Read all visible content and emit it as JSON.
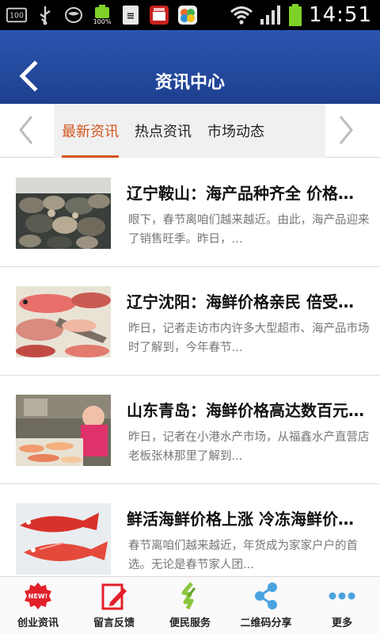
{
  "status_bar": {
    "time": "14:51",
    "battery_percent_label": "100%",
    "icons": [
      "storage-100-icon",
      "usb-icon",
      "mask-icon",
      "battery-100-icon",
      "ime-icon",
      "news-app-icon",
      "flower-app-icon",
      "wifi-icon",
      "signal-icon",
      "battery-icon"
    ]
  },
  "header": {
    "title": "资讯中心",
    "back_icon": "chevron-left-icon"
  },
  "tabs": {
    "items": [
      {
        "label": "最新资讯",
        "active": true
      },
      {
        "label": "热点资讯",
        "active": false
      },
      {
        "label": "市场动态",
        "active": false
      }
    ],
    "accent_color": "#d2541d"
  },
  "news": [
    {
      "title": "辽宁鞍山：海产品种齐全 价格平稳",
      "summary": "眼下，春节离咱们越来越近。由此，海产品迎来了销售旺季。昨日，..."
    },
    {
      "title": "辽宁沈阳：海鲜价格亲民 倍受青睐",
      "summary": "昨日，记者走访市内许多大型超市、海产品市场时了解到，今年春节..."
    },
    {
      "title": "山东青岛：海鲜价格高达数百元一斤",
      "summary": "昨日，记者在小港水产市场，从福鑫水产直营店老板张林那里了解到..."
    },
    {
      "title": "鲜活海鲜价格上涨 冷冻海鲜价格平稳",
      "summary": "春节离咱们越来越近，年货成为家家户户的首选。无论是春节家人团..."
    }
  ],
  "bottom_nav": [
    {
      "label": "创业资讯",
      "icon": "new-badge-icon"
    },
    {
      "label": "留言反馈",
      "icon": "edit-note-icon"
    },
    {
      "label": "便民服务",
      "icon": "service-leaf-icon"
    },
    {
      "label": "二维码分享",
      "icon": "share-icon"
    },
    {
      "label": "更多",
      "icon": "more-dots-icon"
    }
  ],
  "colors": {
    "header": "#1d3f8e",
    "tab_strip": "#f0f0f0",
    "summary_text": "#777777"
  }
}
